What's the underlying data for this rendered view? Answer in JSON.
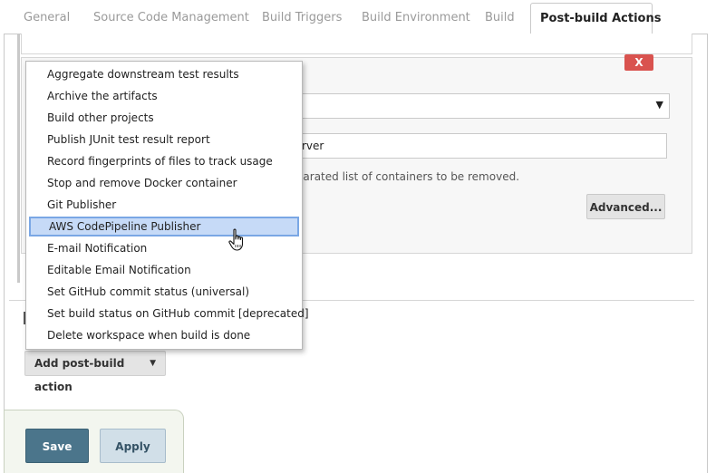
{
  "tabs": [
    "General",
    "Source Code Management",
    "Build Triggers",
    "Build Environment",
    "Build",
    "Post-build Actions"
  ],
  "active_tab": "Post-build Actions",
  "section": {
    "delete_label": "X",
    "select_value": "",
    "text_value": "-server",
    "help_text": "a separated list of containers to be removed.",
    "advanced_label": "Advanced..."
  },
  "add_action_label": "Add post-build action",
  "save_label": "Save",
  "apply_label": "Apply",
  "menu": {
    "items": [
      "Aggregate downstream test results",
      "Archive the artifacts",
      "Build other projects",
      "Publish JUnit test result report",
      "Record fingerprints of files to track usage",
      "Stop and remove Docker container",
      "Git Publisher",
      "AWS CodePipeline Publisher",
      "E-mail Notification",
      "Editable Email Notification",
      "Set GitHub commit status (universal)",
      "Set build status on GitHub commit [deprecated]",
      "Delete workspace when build is done"
    ],
    "highlighted": "AWS CodePipeline Publisher"
  },
  "icons": {
    "cursor": "hand-pointer-icon",
    "caret": "caret-down-icon"
  },
  "colors": {
    "accent": "#4b758b",
    "danger": "#d9534f",
    "highlight": "#c6daf7"
  }
}
